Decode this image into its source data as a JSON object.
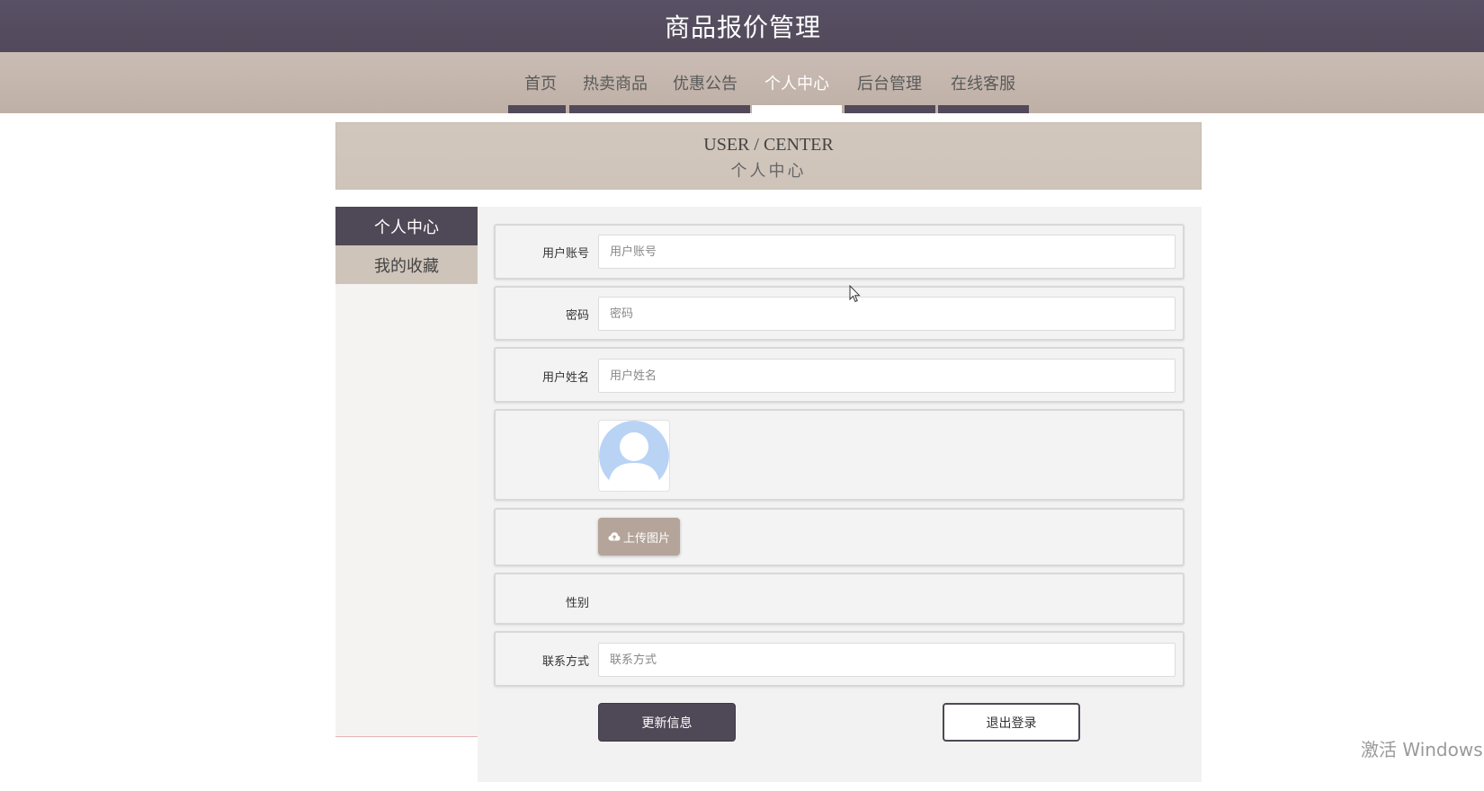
{
  "header": {
    "title": "商品报价管理"
  },
  "nav": {
    "items": [
      {
        "label": "首页"
      },
      {
        "label": "热卖商品"
      },
      {
        "label": "优惠公告"
      },
      {
        "label": "个人中心"
      },
      {
        "label": "后台管理"
      },
      {
        "label": "在线客服"
      }
    ],
    "active_index": 3
  },
  "banner": {
    "en": "USER / CENTER",
    "cn": "个人中心"
  },
  "sidebar": {
    "items": [
      {
        "label": "个人中心",
        "active": true
      },
      {
        "label": "我的收藏",
        "active": false
      }
    ]
  },
  "form": {
    "username": {
      "label": "用户账号",
      "placeholder": "用户账号",
      "value": ""
    },
    "password": {
      "label": "密码",
      "placeholder": "密码",
      "value": ""
    },
    "realname": {
      "label": "用户姓名",
      "placeholder": "用户姓名",
      "value": ""
    },
    "upload_label": "上传图片",
    "gender": {
      "label": "性别"
    },
    "contact": {
      "label": "联系方式",
      "placeholder": "联系方式",
      "value": ""
    }
  },
  "buttons": {
    "update": "更新信息",
    "logout": "退出登录"
  },
  "watermark": "激活 Windows",
  "colors": {
    "header_bg": "#524a5a",
    "nav_bg": "#c5b7ad",
    "accent": "#4f4856",
    "upload_bg": "#b4a49a",
    "avatar": "#b9d3f5"
  }
}
